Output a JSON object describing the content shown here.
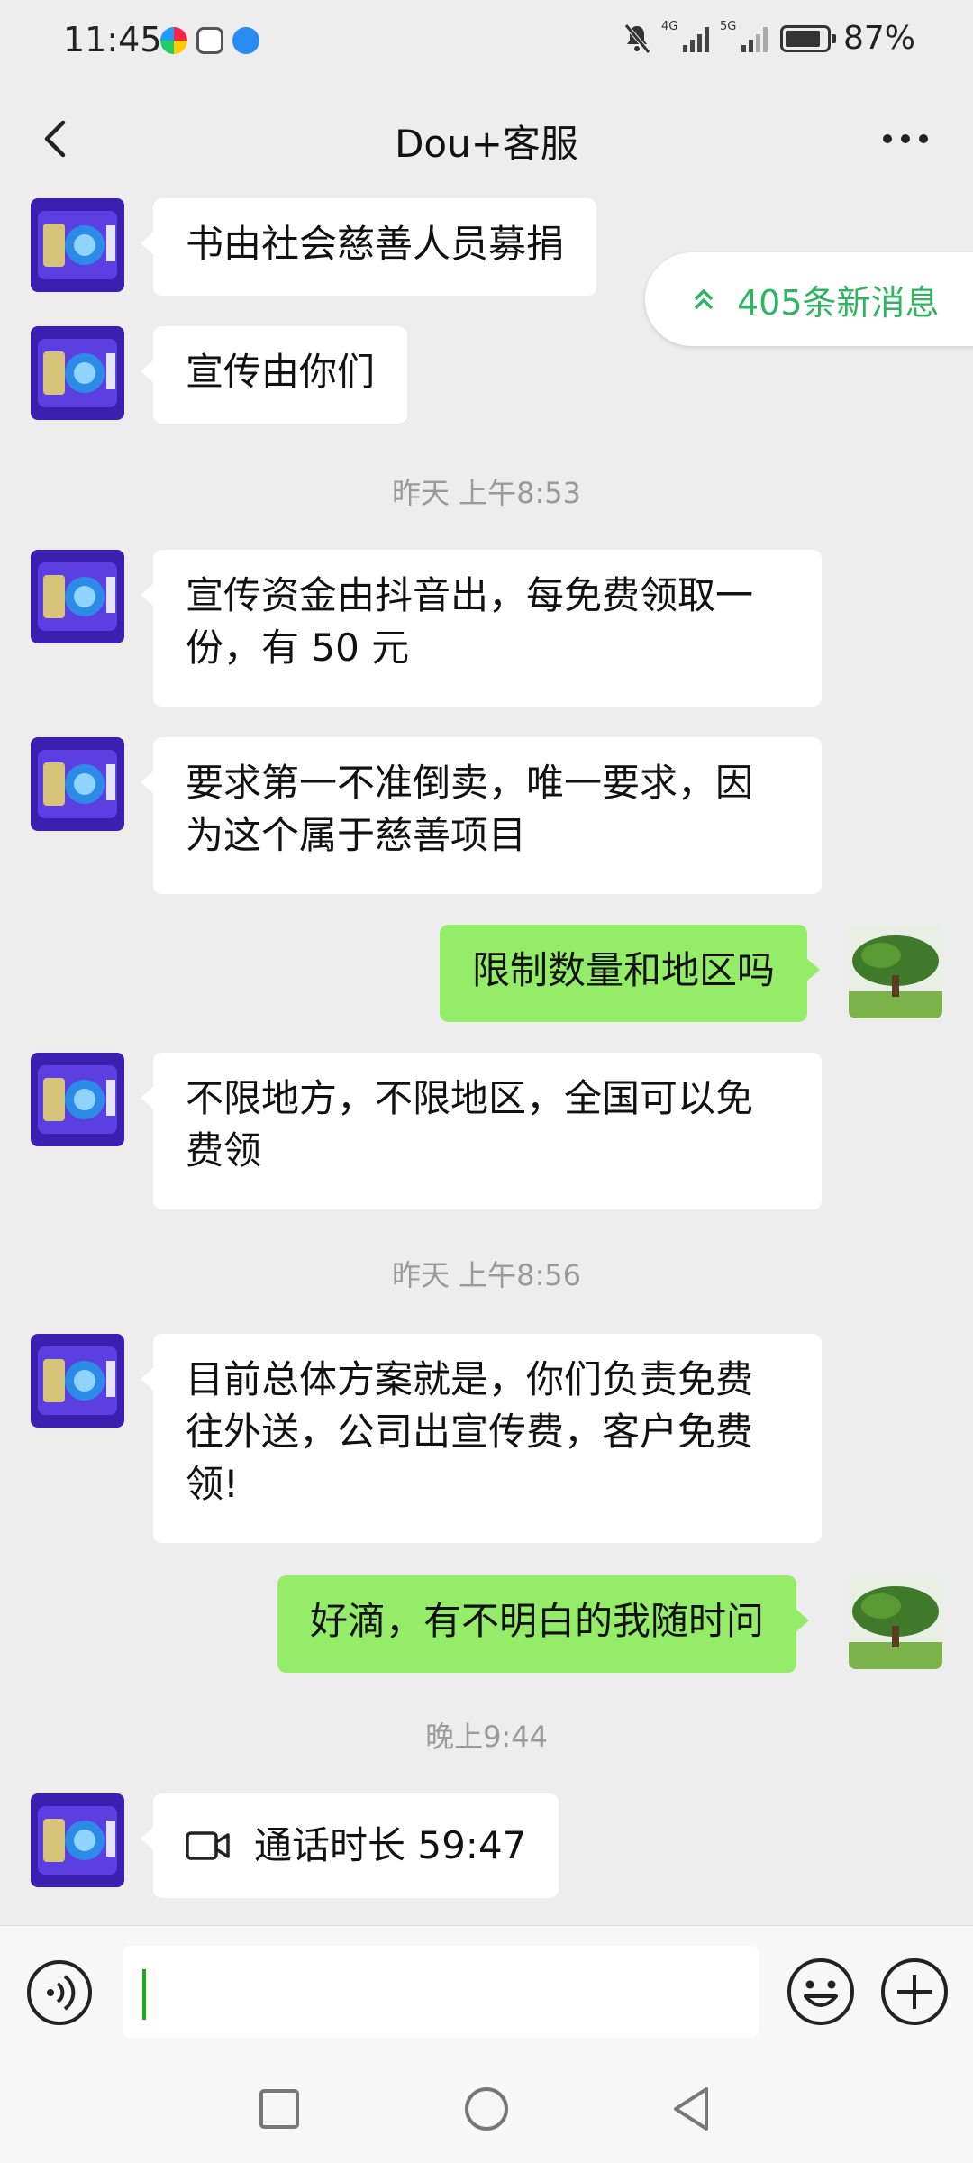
{
  "status_bar": {
    "time": "11:45",
    "battery": "87%",
    "battery_level": 0.87,
    "net1": "4G",
    "net2": "5G"
  },
  "header": {
    "title": "Dou+客服"
  },
  "new_messages": "405条新消息",
  "messages": [
    {
      "text": "书由社会慈善人员募捐"
    },
    {
      "text": "宣传由你们"
    },
    {
      "text": "宣传资金由抖音出，每免费领取一份，有 50 元"
    },
    {
      "text": "要求第一不准倒卖，唯一要求，因为这个属于慈善项目"
    },
    {
      "text": "限制数量和地区吗"
    },
    {
      "text": "不限地方，不限地区，全国可以免费领"
    },
    {
      "text": "目前总体方案就是，你们负责免费往外送，公司出宣传费，客户免费领!"
    },
    {
      "text": "好滴，有不明白的我随时问"
    },
    {
      "text": "通话时长 59:47"
    }
  ],
  "timestamps": [
    "昨天 上午8:53",
    "昨天 上午8:56",
    "晚上9:44"
  ],
  "icons": {
    "back": "back-arrow-icon",
    "more": "more-dots-icon",
    "voice": "voice-icon",
    "emoji": "emoji-icon",
    "plus": "plus-icon",
    "video_call": "video-call-icon"
  },
  "colors": {
    "sent_bubble": "#95ec69",
    "received_bubble": "#ffffff",
    "accent": "#2fb461",
    "background": "#ededed"
  }
}
